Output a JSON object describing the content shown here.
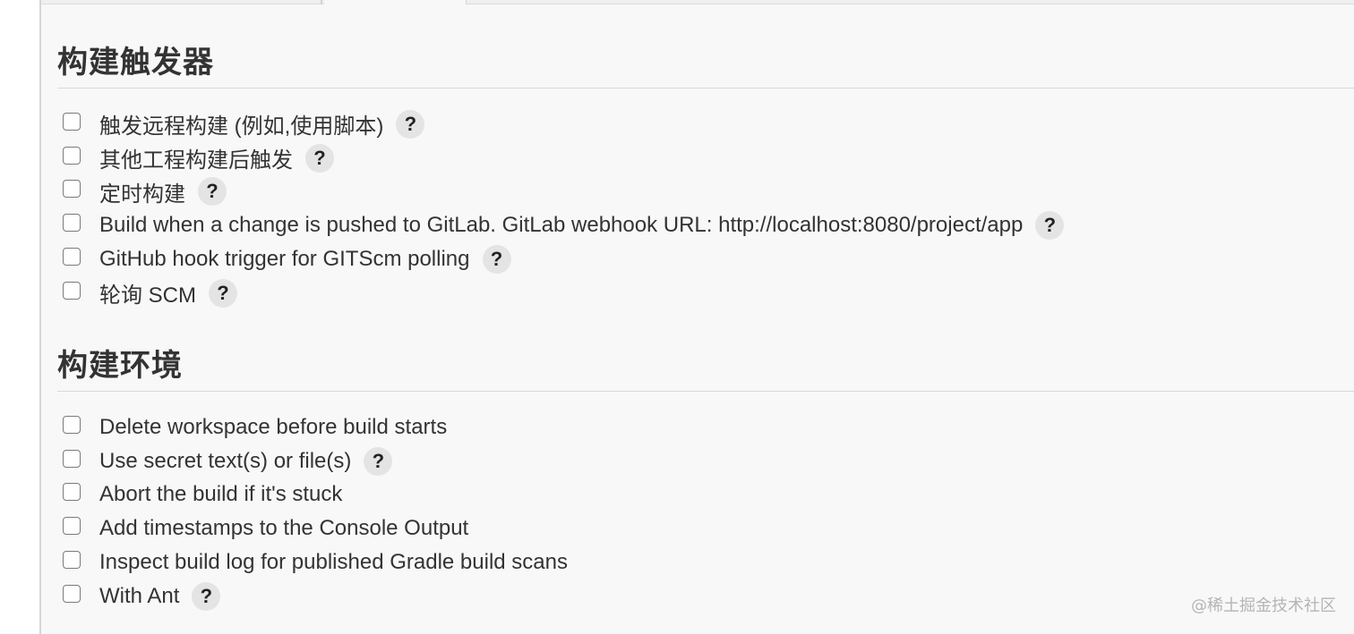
{
  "sections": [
    {
      "title": "构建触发器",
      "items": [
        {
          "label": "触发远程构建 (例如,使用脚本)",
          "checked": false,
          "help": true
        },
        {
          "label": "其他工程构建后触发",
          "checked": false,
          "help": true
        },
        {
          "label": "定时构建",
          "checked": false,
          "help": true
        },
        {
          "label": "Build when a change is pushed to GitLab. GitLab webhook URL: http://localhost:8080/project/app",
          "checked": false,
          "help": true
        },
        {
          "label": "GitHub hook trigger for GITScm polling",
          "checked": false,
          "help": true
        },
        {
          "label": "轮询 SCM",
          "checked": false,
          "help": true
        }
      ]
    },
    {
      "title": "构建环境",
      "items": [
        {
          "label": "Delete workspace before build starts",
          "checked": false,
          "help": false
        },
        {
          "label": "Use secret text(s) or file(s)",
          "checked": false,
          "help": true
        },
        {
          "label": "Abort the build if it's stuck",
          "checked": false,
          "help": false
        },
        {
          "label": "Add timestamps to the Console Output",
          "checked": false,
          "help": false
        },
        {
          "label": "Inspect build log for published Gradle build scans",
          "checked": false,
          "help": false
        },
        {
          "label": "With Ant",
          "checked": false,
          "help": true
        }
      ]
    }
  ],
  "help_glyph": "?",
  "watermark": "@稀土掘金技术社区"
}
